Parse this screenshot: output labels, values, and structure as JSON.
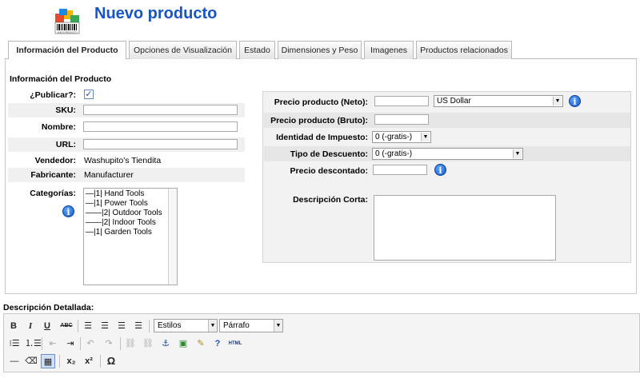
{
  "header": {
    "title": "Nuevo producto",
    "logo_icon": "product-box-barcode-icon",
    "logo_text": "NUEVO PRODUCTO"
  },
  "tabs": [
    {
      "label": "Información del Producto",
      "active": true
    },
    {
      "label": "Opciones de Visualización",
      "active": false
    },
    {
      "label": "Estado",
      "active": false
    },
    {
      "label": "Dimensiones y Peso",
      "active": false
    },
    {
      "label": "Imagenes",
      "active": false
    },
    {
      "label": "Productos relacionados",
      "active": false
    }
  ],
  "product_info": {
    "section_title": "Información del Producto",
    "publish_label": "¿Publicar?:",
    "publish_checked": true,
    "sku_label": "SKU:",
    "sku_value": "",
    "name_label": "Nombre:",
    "name_value": "",
    "url_label": "URL:",
    "url_value": "",
    "vendor_label": "Vendedor:",
    "vendor_value": "Washupito's Tiendita",
    "manufacturer_label": "Fabricante:",
    "manufacturer_value": "Manufacturer",
    "categories_label": "Categorías:",
    "categories": [
      "—|1| Hand Tools",
      "—|1| Power Tools",
      "——|2| Outdoor Tools",
      "——|2| Indoor Tools",
      "—|1| Garden Tools"
    ]
  },
  "pricing": {
    "net_price_label": "Precio producto (Neto):",
    "net_price_value": "",
    "currency_value": "US Dollar",
    "gross_price_label": "Precio producto (Bruto):",
    "gross_price_value": "",
    "tax_label": "Identidad de Impuesto:",
    "tax_value": "0 (-gratis-)",
    "discount_type_label": "Tipo de Descuento:",
    "discount_type_value": "0 (-gratis-)",
    "discounted_price_label": "Precio descontado:",
    "discounted_price_value": "",
    "short_desc_label": "Descripción Corta:",
    "short_desc_value": ""
  },
  "description": {
    "label": "Descripción Detallada:",
    "toolbar": {
      "bold": "B",
      "italic": "I",
      "underline": "U",
      "strikethrough": "ABC",
      "styles_value": "Estilos",
      "format_value": "Párrafo",
      "html_label": "HTML",
      "subscript": "x₂",
      "superscript": "x²",
      "special_char": "Ω"
    }
  }
}
